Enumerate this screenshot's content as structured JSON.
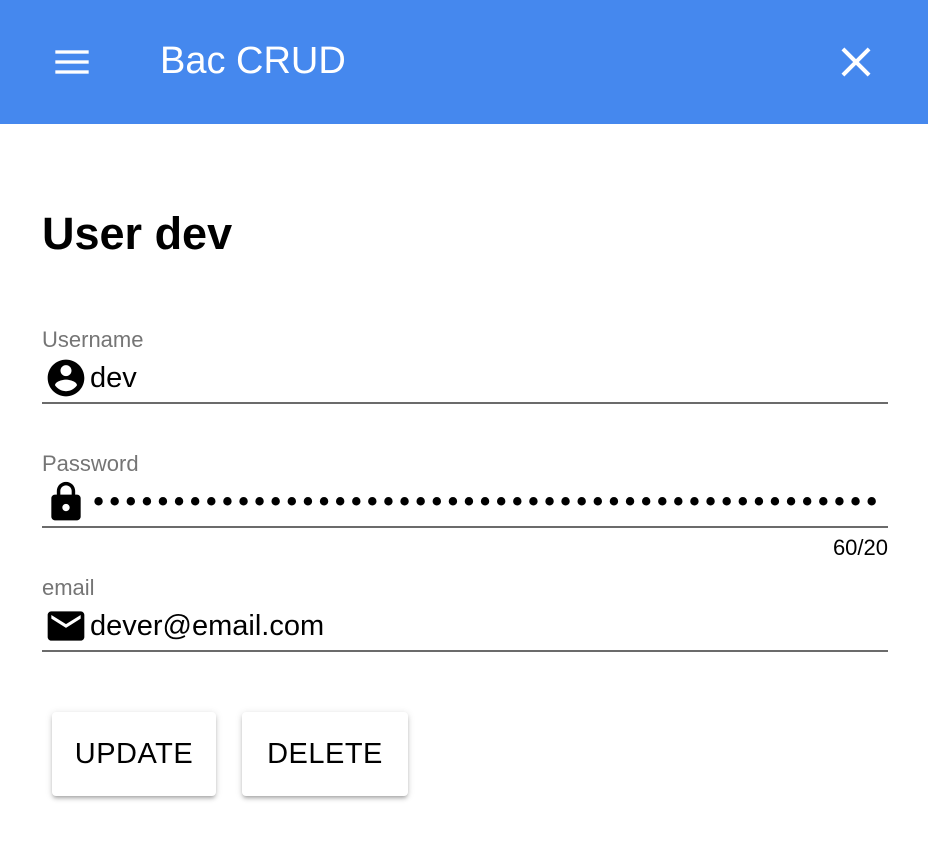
{
  "toolbar": {
    "title": "Bac CRUD",
    "menu_icon": "menu-icon",
    "close_icon": "close-icon",
    "background_color": "#4588ee"
  },
  "page": {
    "title": "User dev"
  },
  "form": {
    "username": {
      "label": "Username",
      "value": "dev",
      "icon": "account-circle-icon"
    },
    "password": {
      "label": "Password",
      "masked_value": "••••••••••••••••••••••••••••••••••••••••••••••••••••••••••••",
      "counter": "60/20",
      "icon": "lock-icon"
    },
    "email": {
      "label": "email",
      "value": "dever@email.com",
      "icon": "mail-icon"
    }
  },
  "actions": {
    "update_label": "UPDATE",
    "delete_label": "DELETE"
  }
}
